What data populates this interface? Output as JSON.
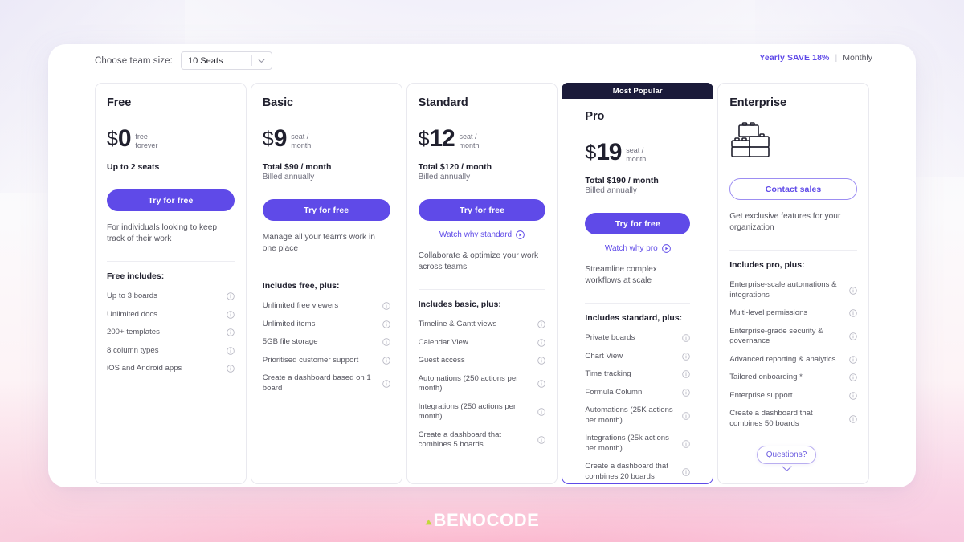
{
  "toolbar": {
    "team_size_label": "Choose team size:",
    "team_size_value": "10 Seats",
    "chevron_icon": "chevron-down-icon",
    "billing_yearly": "Yearly SAVE 18%",
    "billing_separator": "|",
    "billing_monthly": "Monthly"
  },
  "accent_colors": {
    "primary": "#5f4ae8",
    "featured_banner": "#1b1b3a",
    "text_dark": "#20202e",
    "text_muted": "#55555f"
  },
  "plans": [
    {
      "name": "Free",
      "badge": null,
      "currency": "$",
      "amount": "0",
      "unit_line1": "free",
      "unit_line2": "forever",
      "sub_strong": "Up to 2 seats",
      "sub_light": "",
      "cta_label": "Try for free",
      "cta_style": "primary",
      "watch_label": null,
      "description": "For individuals looking to keep track of their work",
      "includes_title": "Free includes:",
      "features": [
        "Up to 3 boards",
        "Unlimited docs",
        "200+ templates",
        "8 column types",
        "iOS and Android apps"
      ]
    },
    {
      "name": "Basic",
      "badge": null,
      "currency": "$",
      "amount": "9",
      "unit_line1": "seat /",
      "unit_line2": "month",
      "sub_strong": "Total $90 / month",
      "sub_light": "Billed annually",
      "cta_label": "Try for free",
      "cta_style": "primary",
      "watch_label": null,
      "description": "Manage all your team's work in one place",
      "includes_title": "Includes free, plus:",
      "features": [
        "Unlimited free viewers",
        "Unlimited items",
        "5GB file storage",
        "Prioritised customer support",
        "Create a dashboard based on 1 board"
      ]
    },
    {
      "name": "Standard",
      "badge": null,
      "currency": "$",
      "amount": "12",
      "unit_line1": "seat /",
      "unit_line2": "month",
      "sub_strong": "Total $120 / month",
      "sub_light": "Billed annually",
      "cta_label": "Try for free",
      "cta_style": "primary",
      "watch_label": "Watch why standard",
      "description": "Collaborate & optimize your work across teams",
      "includes_title": "Includes basic, plus:",
      "features": [
        "Timeline & Gantt views",
        "Calendar View",
        "Guest access",
        "Automations (250 actions per month)",
        "Integrations (250 actions per month)",
        "Create a dashboard that combines 5 boards"
      ]
    },
    {
      "name": "Pro",
      "badge": "Most Popular",
      "currency": "$",
      "amount": "19",
      "unit_line1": "seat /",
      "unit_line2": "month",
      "sub_strong": "Total $190 / month",
      "sub_light": "Billed annually",
      "cta_label": "Try for free",
      "cta_style": "primary",
      "watch_label": "Watch why pro",
      "description": "Streamline complex workflows at scale",
      "includes_title": "Includes standard, plus:",
      "features": [
        "Private boards",
        "Chart View",
        "Time tracking",
        "Formula Column",
        "Automations (25K actions per month)",
        "Integrations (25k actions per month)",
        "Create a dashboard that combines 20 boards"
      ]
    },
    {
      "name": "Enterprise",
      "badge": null,
      "currency": null,
      "amount": null,
      "unit_line1": null,
      "unit_line2": null,
      "sub_strong": "",
      "sub_light": "",
      "icon": "blocks-icon",
      "cta_label": "Contact sales",
      "cta_style": "outline",
      "watch_label": null,
      "description": "Get exclusive features for your organization",
      "includes_title": "Includes pro, plus:",
      "features": [
        "Enterprise-scale automations & integrations",
        "Multi-level permissions",
        "Enterprise-grade security & governance",
        "Advanced reporting & analytics",
        "Tailored onboarding *",
        "Enterprise support",
        "Create a dashboard that combines 50 boards"
      ]
    }
  ],
  "questions_widget": {
    "label": "Questions?",
    "chevron_icon": "chevron-down-icon"
  },
  "footer": {
    "logo_text": "BENOCODE",
    "logo_mark_icon": "benocode-mark-icon",
    "logo_mark_color": "#c3d83a"
  }
}
